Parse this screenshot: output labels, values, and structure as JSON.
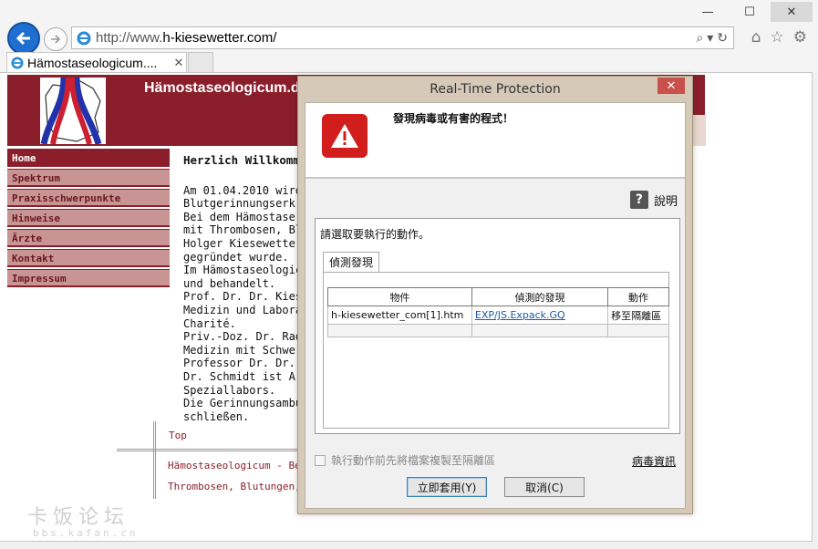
{
  "browser": {
    "window_controls": {
      "minimize": "—",
      "maximize": "☐",
      "close": "✕"
    },
    "url_prefix": "http://www.",
    "url_domain": "h-kiesewetter.com/",
    "tab_title": "Hämostaseologicum....",
    "tab_close": "✕"
  },
  "site": {
    "title": "Hämostaseologicum.d",
    "nav": [
      "Home",
      "Spektrum",
      "Praxisschwerpunkte",
      "Hinweise",
      "Ärzte",
      "Kontakt",
      "Impressum"
    ],
    "welcome": "Herzlich Willkomm",
    "body_lines": [
      "Am 01.04.2010 wird",
      "Blutgerinnungserkra",
      "Bei dem Hämostase",
      "mit Thrombosen, Blu",
      "Holger Kiesewetter,",
      "gegründet wurde.",
      "Im Hämostaseologic",
      "und behandelt.",
      "Prof. Dr. Dr. Kiesewe",
      "Medizin und Laborat",
      "Charité.",
      "Priv.-Doz. Dr. Radtke",
      "Medizin mit Schwerp",
      "Professor Dr. Dr. Kie",
      "Dr. Schmidt ist Arzt f",
      "Speziallabors.",
      "Die Gerinnungsambul",
      "schließen."
    ],
    "footer_top": "Top",
    "footer_line1": "Hämostaseologicum - Be",
    "footer_line2": "Thrombosen, Blutungen,"
  },
  "dialog": {
    "title": "Real-Time Protection",
    "close": "✕",
    "heading": "發現病毒或有害的程式！",
    "help_label": "說明",
    "prompt": "請選取要執行的動作。",
    "tab_label": "偵測發現",
    "columns": [
      "物件",
      "偵測的發現",
      "動作"
    ],
    "rows": [
      {
        "object": "h-kiesewetter_com[1].htm",
        "detection": "EXP/JS.Expack.GQ",
        "action": "移至隔離區"
      }
    ],
    "checkbox_label": "執行動作前先將檔案複製至隔離區",
    "virus_info": "病毒資訊",
    "apply_button": "立即套用(Y)",
    "cancel_button": "取消(C)"
  },
  "watermark": {
    "main": "卡饭论坛",
    "sub": "bbs.kafan.cn"
  }
}
